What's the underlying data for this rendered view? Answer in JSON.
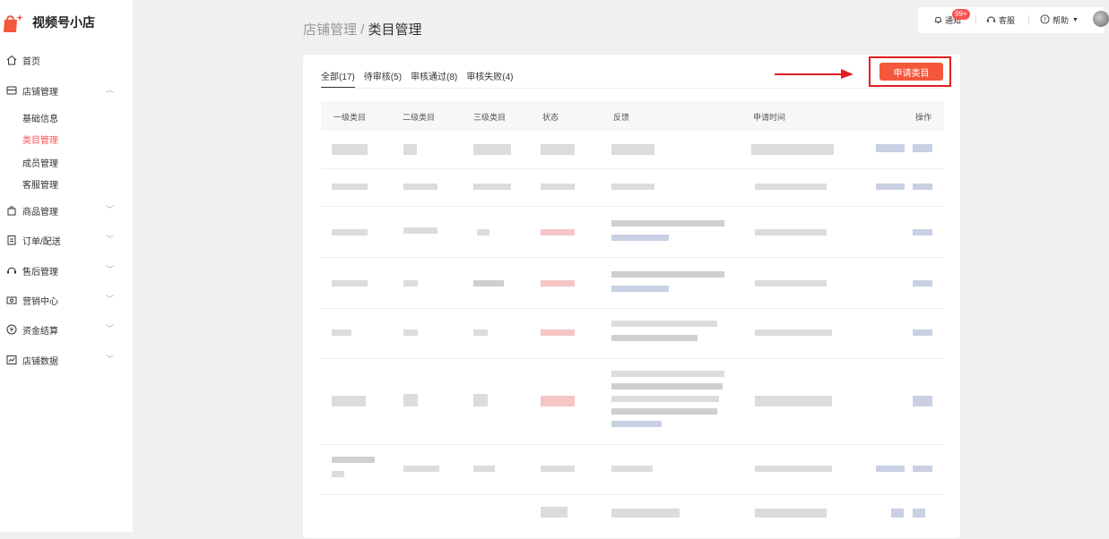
{
  "app": {
    "brand_title": "视频号小店"
  },
  "sidebar": {
    "items": [
      {
        "id": "home",
        "label": "首页",
        "icon": "home-icon",
        "has_children": false
      },
      {
        "id": "store",
        "label": "店铺管理",
        "icon": "store-icon",
        "has_children": true,
        "expanded": true
      },
      {
        "id": "products",
        "label": "商品管理",
        "icon": "bag-icon",
        "has_children": true
      },
      {
        "id": "orders",
        "label": "订单/配送",
        "icon": "clipboard-icon",
        "has_children": true
      },
      {
        "id": "aftersale",
        "label": "售后管理",
        "icon": "headset-icon",
        "has_children": true
      },
      {
        "id": "marketing",
        "label": "营销中心",
        "icon": "ticket-icon",
        "has_children": true
      },
      {
        "id": "finance",
        "label": "资金结算",
        "icon": "yen-icon",
        "has_children": true
      },
      {
        "id": "data",
        "label": "店铺数据",
        "icon": "chart-icon",
        "has_children": true
      }
    ],
    "store_subitems": [
      {
        "label": "基础信息",
        "active": false
      },
      {
        "label": "类目管理",
        "active": true
      },
      {
        "label": "成员管理",
        "active": false
      },
      {
        "label": "客服管理",
        "active": false
      }
    ]
  },
  "header": {
    "breadcrumb_parent": "店铺管理",
    "breadcrumb_sep": "/",
    "breadcrumb_current": "类目管理",
    "notifications_label": "通知",
    "notifications_badge": "99+",
    "service_label": "客服",
    "help_label": "帮助"
  },
  "tabs": [
    {
      "label": "全部(17)",
      "active": true
    },
    {
      "label": "待审核(5)",
      "active": false
    },
    {
      "label": "审核通过(8)",
      "active": false
    },
    {
      "label": "审核失败(4)",
      "active": false
    }
  ],
  "apply_button_label": "申请类目",
  "table": {
    "columns": [
      "一级类目",
      "二级类目",
      "三级类目",
      "状态",
      "反馈",
      "申请时间",
      "操作"
    ]
  },
  "colors": {
    "accent": "#fa5151",
    "button": "#f5573a",
    "highlight_box": "#e02020",
    "arrow": "#e02020"
  }
}
